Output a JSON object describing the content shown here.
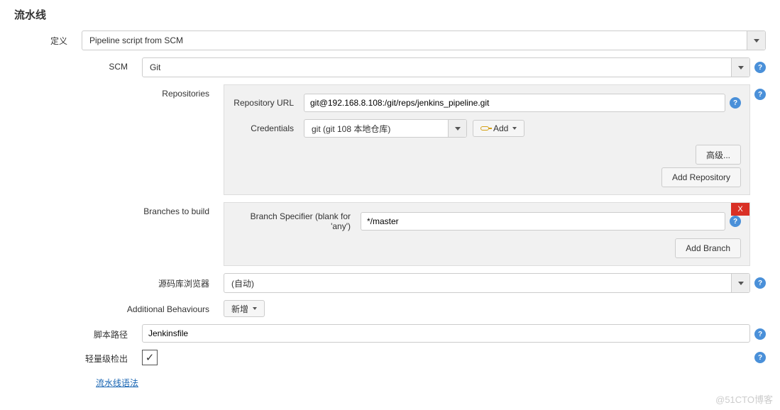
{
  "section_title": "流水线",
  "definition": {
    "label": "定义",
    "value": "Pipeline script from SCM"
  },
  "scm": {
    "label": "SCM",
    "value": "Git"
  },
  "repositories": {
    "label": "Repositories",
    "repo_url_label": "Repository URL",
    "repo_url_value": "git@192.168.8.108:/git/reps/jenkins_pipeline.git",
    "credentials_label": "Credentials",
    "credentials_value": "git (git 108 本地仓库)",
    "add_cred_label": "Add",
    "advanced_btn": "高级...",
    "add_repo_btn": "Add Repository"
  },
  "branches": {
    "label": "Branches to build",
    "specifier_label": "Branch Specifier (blank for 'any')",
    "specifier_value": "*/master",
    "close_x": "X",
    "add_branch_btn": "Add Branch"
  },
  "repo_browser": {
    "label": "源码库浏览器",
    "value": "(自动)"
  },
  "additional": {
    "label": "Additional Behaviours",
    "add_btn": "新增"
  },
  "script_path": {
    "label": "脚本路径",
    "value": "Jenkinsfile"
  },
  "lightweight": {
    "label": "轻量级检出",
    "checked_glyph": "✓"
  },
  "syntax_link": "流水线语法",
  "watermark": "@51CTO博客"
}
